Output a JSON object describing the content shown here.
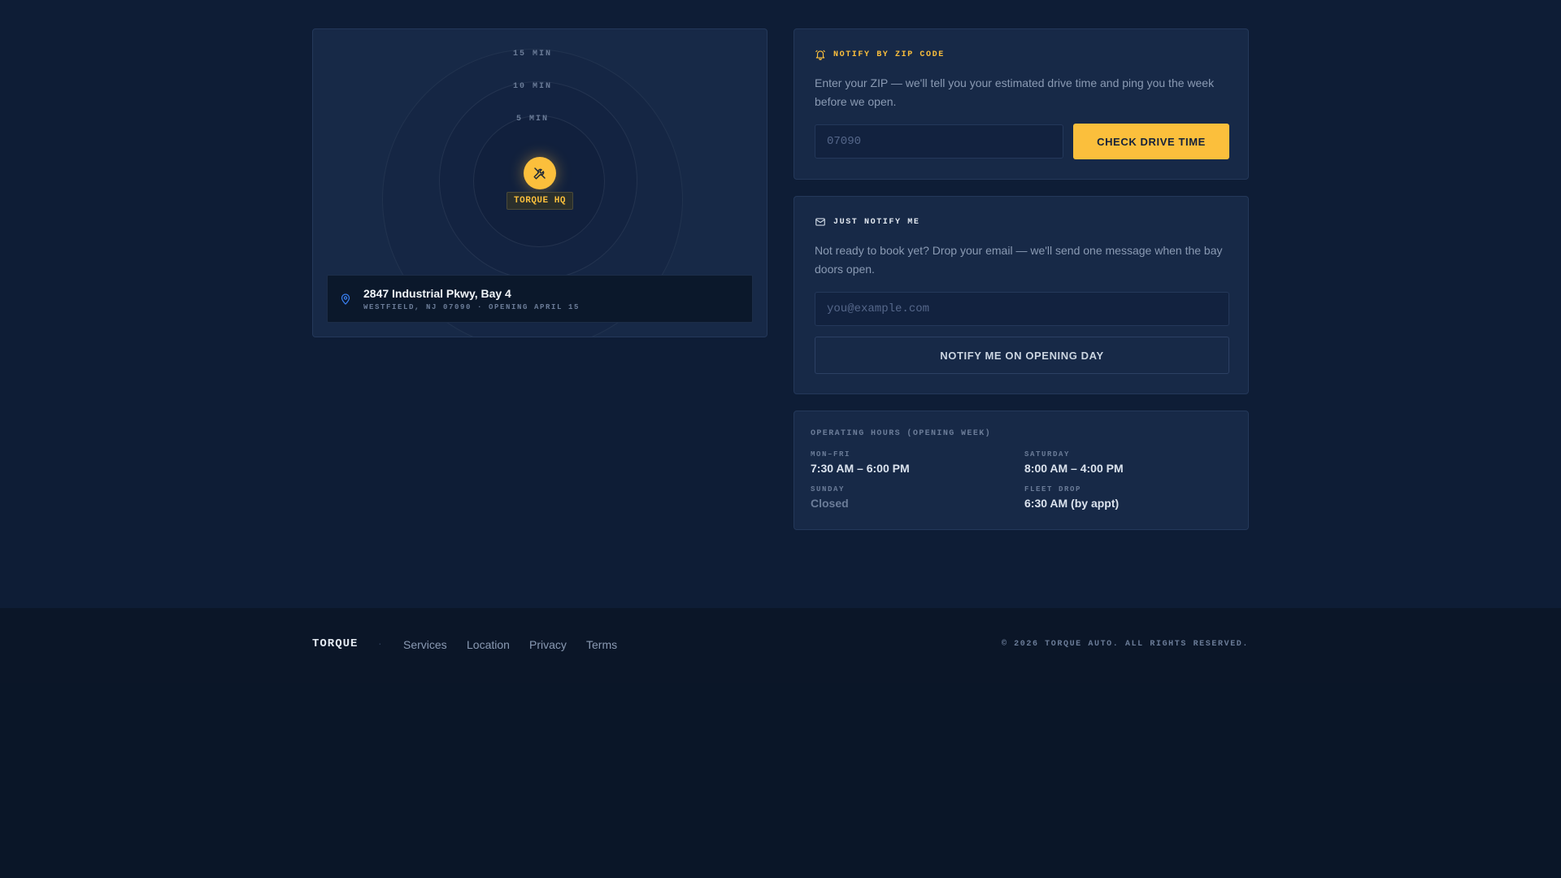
{
  "colors": {
    "accent": "#fbbf3c",
    "page_background": "#0e1d36",
    "card_background": "#172947",
    "footer_background": "#0b1628",
    "pin_icon": "#3b82f6"
  },
  "map": {
    "rings": [
      "15 MIN",
      "10 MIN",
      "5 MIN"
    ],
    "hq_label": "TORQUE HQ",
    "hq_icon": "wrench-screwdriver-icon",
    "address_icon": "map-pin-icon",
    "address_line": "2847 Industrial Pkwy, Bay 4",
    "address_sub": "WESTFIELD, NJ 07090 · OPENING APRIL 15"
  },
  "zip_card": {
    "icon": "bell-icon",
    "heading": "NOTIFY BY ZIP CODE",
    "description": "Enter your ZIP — we'll tell you your estimated drive time and ping you the week before we open.",
    "input_placeholder": "07090",
    "input_value": "",
    "button_label": "CHECK DRIVE TIME"
  },
  "notify_card": {
    "icon": "envelope-icon",
    "heading": "JUST NOTIFY ME",
    "description": "Not ready to book yet? Drop your email — we'll send one message when the bay doors open.",
    "input_placeholder": "you@example.com",
    "input_value": "",
    "button_label": "NOTIFY ME ON OPENING DAY"
  },
  "hours": {
    "title": "OPERATING HOURS (OPENING WEEK)",
    "entries": [
      {
        "label": "MON–FRI",
        "value": "7:30 AM – 6:00 PM"
      },
      {
        "label": "SATURDAY",
        "value": "8:00 AM – 4:00 PM"
      },
      {
        "label": "SUNDAY",
        "value": "Closed"
      },
      {
        "label": "FLEET DROP",
        "value": "6:30 AM (by appt)"
      }
    ]
  },
  "footer": {
    "brand": "TORQUE",
    "separator": "·",
    "links": [
      "Services",
      "Location",
      "Privacy",
      "Terms"
    ],
    "copyright": "© 2026 TORQUE AUTO. ALL RIGHTS RESERVED."
  }
}
